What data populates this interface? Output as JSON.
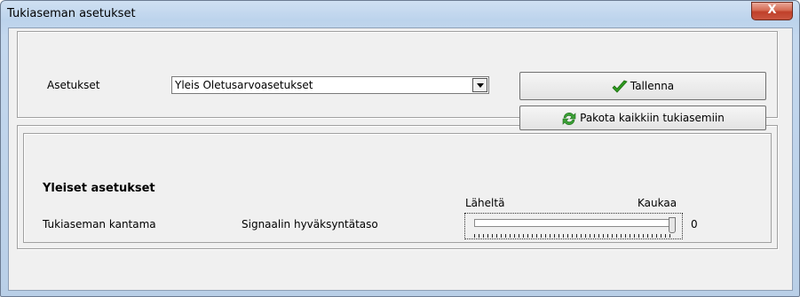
{
  "window": {
    "title": "Tukiaseman asetukset",
    "close_label": "X"
  },
  "settings": {
    "label": "Asetukset",
    "selected": "Yleis Oletusarvoasetukset"
  },
  "buttons": {
    "save_label": "Tallenna",
    "force_label": "Pakota kaikkiin tukiasemiin"
  },
  "general": {
    "heading": "Yleiset asetukset",
    "range_label": "Tukiaseman kantama",
    "signal_label": "Signaalin hyväksyntätaso",
    "slider_min_label": "Läheltä",
    "slider_max_label": "Kaukaa",
    "slider_value": "0",
    "slider_fraction": 1.0
  },
  "icons": {
    "save": "checkmark-icon",
    "force": "sync-icon"
  },
  "colors": {
    "checkmark": "#2e9a1f",
    "sync": "#3aa035"
  }
}
